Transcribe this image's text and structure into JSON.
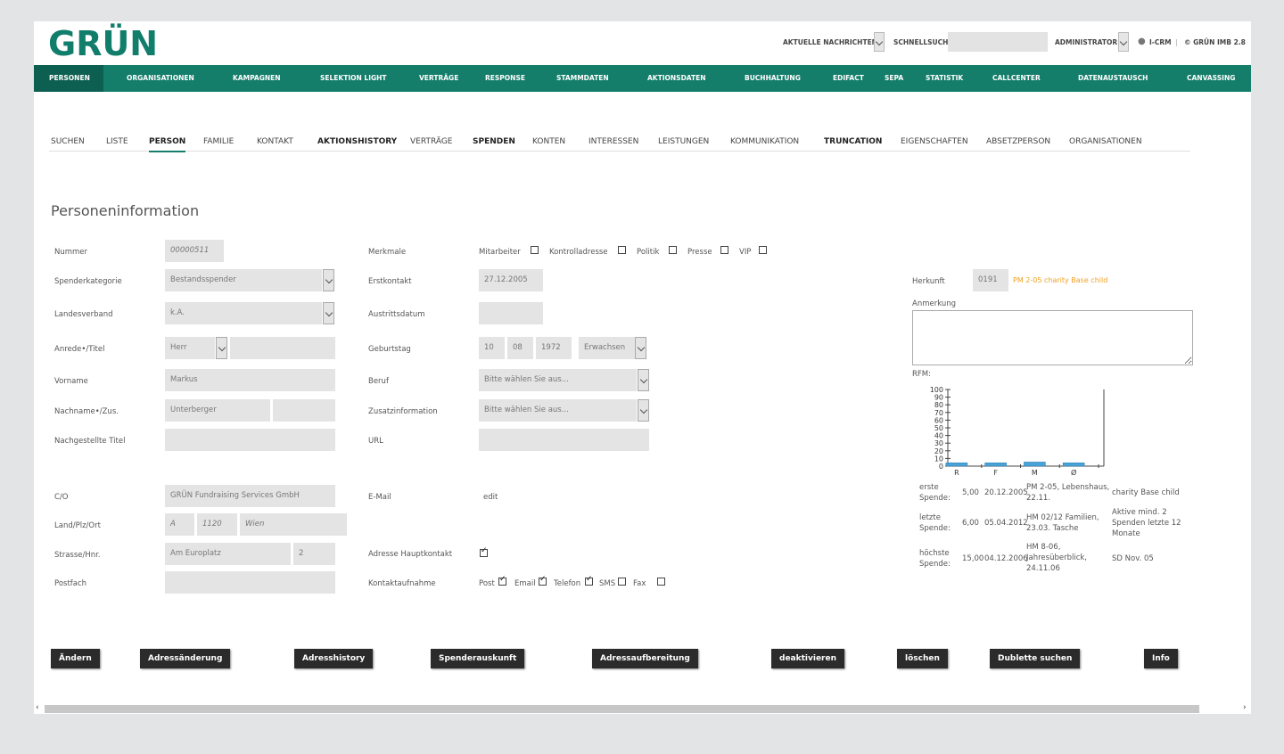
{
  "header": {
    "logo": "GRÜN",
    "news_label": "AKTUELLE NACHRICHTEN",
    "quicksearch_label": "SCHNELLSUCHE:",
    "quicksearch_value": "",
    "user_label": "ADMINISTRATOR",
    "icrm_label": "I-CRM",
    "separator": "|",
    "version_label": "© GRÜN IMB 2.8"
  },
  "mainnav": [
    "PERSONEN",
    "ORGANISATIONEN",
    "KAMPAGNEN",
    "SELEKTION LIGHT",
    "VERTRÄGE",
    "RESPONSE",
    "STAMMDATEN",
    "AKTIONSDATEN",
    "BUCHHALTUNG",
    "EDIFACT",
    "SEPA",
    "STATISTIK",
    "CALLCENTER",
    "DATENAUSTAUSCH",
    "CANVASSING"
  ],
  "subtabs": [
    "SUCHEN",
    "LISTE",
    "PERSON",
    "FAMILIE",
    "KONTAKT",
    "AKTIONSHISTORY",
    "VERTRÄGE",
    "SPENDEN",
    "KONTEN",
    "INTERESSEN",
    "LEISTUNGEN",
    "KOMMUNIKATION",
    "TRUNCATION",
    "EIGENSCHAFTEN",
    "ABSETZPERSON",
    "ORGANISATIONEN"
  ],
  "section_title": "Personeninformation",
  "form": {
    "nummer_label": "Nummer",
    "nummer": "00000511",
    "spenderkategorie_label": "Spenderkategorie",
    "spenderkategorie": "Bestandsspender",
    "landesverband_label": "Landesverband",
    "landesverband": "k.A.",
    "anrede_label": "Anrede•/Titel",
    "anrede": "Herr",
    "titel": "",
    "vorname_label": "Vorname",
    "vorname": "Markus",
    "nachname_label": "Nachname•/Zus.",
    "nachname": "Unterberger",
    "zusatz": "",
    "nachgestellt_label": "Nachgestellte Titel",
    "nachgestellt": "",
    "co_label": "C/O",
    "co": "GRÜN Fundraising Services GmbH",
    "landplzort_label": "Land/Plz/Ort",
    "land": "A",
    "plz": "1120",
    "ort": "Wien",
    "strasse_label": "Strasse/Hnr.",
    "strasse": "Am Europlatz",
    "hnr": "2",
    "postfach_label": "Postfach",
    "postfach": "",
    "merkmale_label": "Merkmale",
    "merkmale": [
      "Mitarbeiter",
      "Kontrolladresse",
      "Politik",
      "Presse",
      "VIP"
    ],
    "erstkontakt_label": "Erstkontakt",
    "erstkontakt": "27.12.2005",
    "austritt_label": "Austrittsdatum",
    "austritt": "",
    "geburtstag_label": "Geburtstag",
    "geb_tag": "10",
    "geb_monat": "08",
    "geb_jahr": "1972",
    "altersgruppe": "Erwachsen",
    "beruf_label": "Beruf",
    "beruf": "Bitte wählen Sie aus...",
    "zusatzinfo_label": "Zusatzinformation",
    "zusatzinfo": "Bitte wählen Sie aus...",
    "url_label": "URL",
    "url": "",
    "email_label": "E-Mail",
    "email_edit": "edit",
    "hauptkontakt_label": "Adresse Hauptkontakt",
    "kontaktaufnahme_label": "Kontaktaufnahme",
    "kontakt_options": [
      "Post",
      "Email",
      "Telefon",
      "SMS",
      "Fax"
    ],
    "herkunft_label": "Herkunft",
    "herkunft_code": "0191",
    "herkunft_text": "PM 2-05 charity Base child",
    "anmerkung_label": "Anmerkung",
    "rfm_label": "RFM:"
  },
  "chart_data": {
    "type": "bar",
    "categories": [
      "R",
      "F",
      "M",
      "Ø"
    ],
    "values": [
      2,
      2,
      3,
      2
    ],
    "ylim": [
      0,
      100
    ],
    "yticks": [
      "100",
      "90",
      "80",
      "70",
      "60",
      "50",
      "40",
      "30",
      "20",
      "10",
      "0"
    ]
  },
  "stats": [
    {
      "label": "erste Spende:",
      "amount": "5,00",
      "date": "20.12.2005",
      "campaign": "PM 2-05, Lebenshaus, 22.11.",
      "note": "charity Base child"
    },
    {
      "label": "letzte Spende:",
      "amount": "6,00",
      "date": "05.04.2012",
      "campaign": "HM 02/12 Familien, 23.03. Tasche",
      "note": "Aktive mind. 2 Spenden letzte 12 Monate"
    },
    {
      "label": "höchste Spende:",
      "amount": "15,00",
      "date": "04.12.2006",
      "campaign": "HM 8-06, Jahresüberblick, 24.11.06",
      "note": "SD Nov. 05"
    }
  ],
  "buttons": [
    "Ändern",
    "Adressänderung",
    "Adresshistory",
    "Spenderauskunft",
    "Adressaufbereitung",
    "deaktivieren",
    "löschen",
    "Dublette suchen",
    "Info"
  ],
  "scroll": {
    "left": "‹",
    "right": "›"
  }
}
